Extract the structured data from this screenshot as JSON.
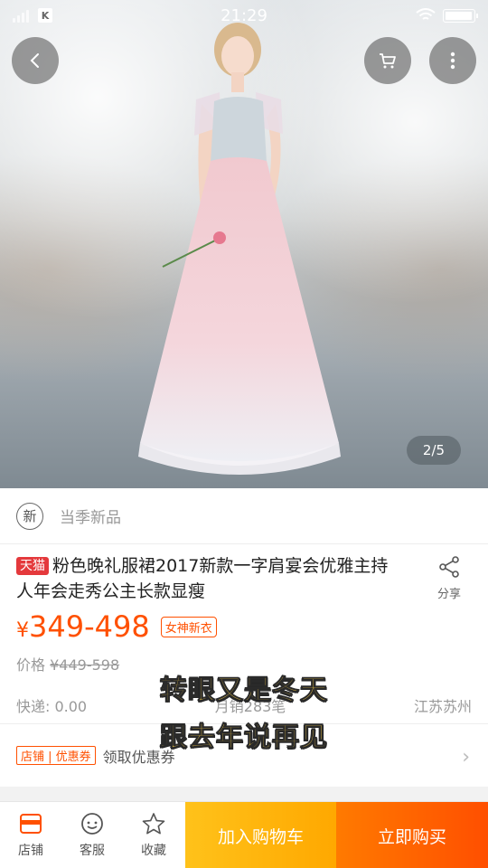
{
  "status_bar": {
    "time": "21:29",
    "carrier_badge": "K"
  },
  "hero": {
    "page_indicator": "2/5",
    "icons": [
      "back-icon",
      "cart-icon",
      "more-icon"
    ]
  },
  "season": {
    "badge": "新",
    "label": "当季新品"
  },
  "product": {
    "platform_tag": "天猫",
    "title": "粉色晚礼服裙2017新款一字肩宴会优雅主持人年会走秀公主长款显瘦",
    "share_label": "分享",
    "price_symbol": "¥",
    "price": "349-498",
    "price_tag": "女神新衣",
    "orig_label": "价格",
    "orig_price": "¥449-598",
    "shipping": "快递: 0.00",
    "monthly_sales": "月销283笔",
    "location": "江苏苏州"
  },
  "captions": [
    "转眼又是冬天",
    "跟去年说再见"
  ],
  "coupon": {
    "tag": "店铺 | 优惠券",
    "text": "领取优惠券"
  },
  "bottom_bar": {
    "shop_label": "店铺",
    "service_label": "客服",
    "favorite_label": "收藏",
    "cart_button": "加入购物车",
    "buy_button": "立即购买"
  },
  "colors": {
    "accent": "#ff5000",
    "cart_button": "#ffb300",
    "buy_button": "#ff5a00",
    "tmall": "#e4393c"
  }
}
